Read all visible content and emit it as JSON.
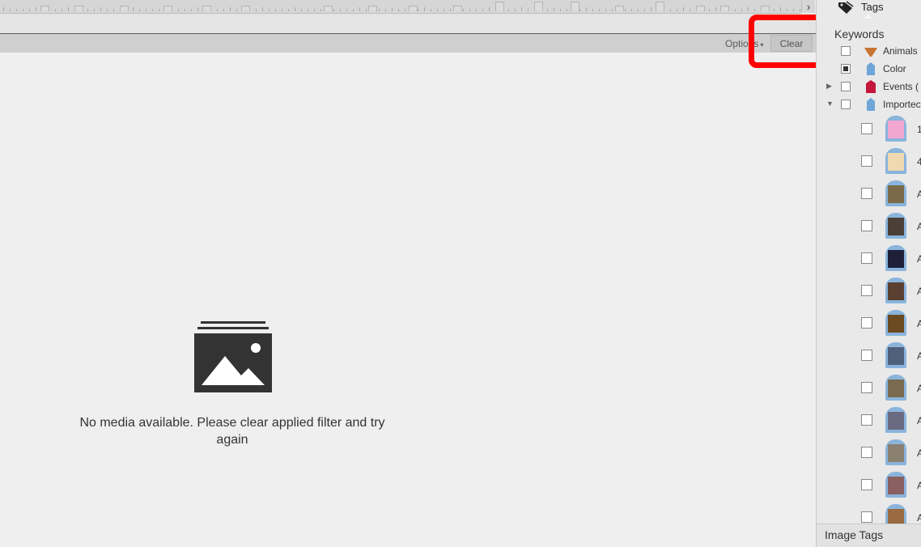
{
  "filter_bar": {
    "options_label": "Options",
    "clear_label": "Clear"
  },
  "empty_state": {
    "message": "No media available. Please clear applied filter and try again"
  },
  "tags_panel": {
    "tab_label": "Tags",
    "keywords_header": "Keywords",
    "categories": [
      {
        "label": "Animals",
        "icon": "animals-tag-icon",
        "color": "#c87433",
        "expander": "none",
        "checkbox": "unchecked"
      },
      {
        "label": "Color",
        "icon": "color-tag-icon",
        "color": "#6fa6d8",
        "expander": "none",
        "checkbox": "mixed"
      },
      {
        "label": "Events (",
        "icon": "events-tag-icon",
        "color": "#c4173b",
        "expander": "collapsed",
        "checkbox": "unchecked"
      },
      {
        "label": "Importec",
        "icon": "imported-tag-icon",
        "color": "#6fa6d8",
        "expander": "expanded",
        "checkbox": "unchecked"
      }
    ],
    "imported_tags": [
      {
        "label": "1",
        "photo_color": "#f2a7d0"
      },
      {
        "label": "4",
        "photo_color": "#f0d8b0"
      },
      {
        "label": "A",
        "photo_color": "#7a6a4a"
      },
      {
        "label": "A",
        "photo_color": "#4a4038"
      },
      {
        "label": "A",
        "photo_color": "#1f1f3a"
      },
      {
        "label": "A",
        "photo_color": "#5a4030"
      },
      {
        "label": "A",
        "photo_color": "#6a4a20"
      },
      {
        "label": "A",
        "photo_color": "#50607a"
      },
      {
        "label": "A",
        "photo_color": "#7a6a50"
      },
      {
        "label": "A",
        "photo_color": "#6a6a80"
      },
      {
        "label": "A",
        "photo_color": "#8a8070"
      },
      {
        "label": "A",
        "photo_color": "#8a6060"
      },
      {
        "label": "A",
        "photo_color": "#9a6a40"
      }
    ],
    "footer_label": "Image Tags"
  },
  "colors": {
    "highlight": "#ff0000",
    "background": "#efefef"
  }
}
